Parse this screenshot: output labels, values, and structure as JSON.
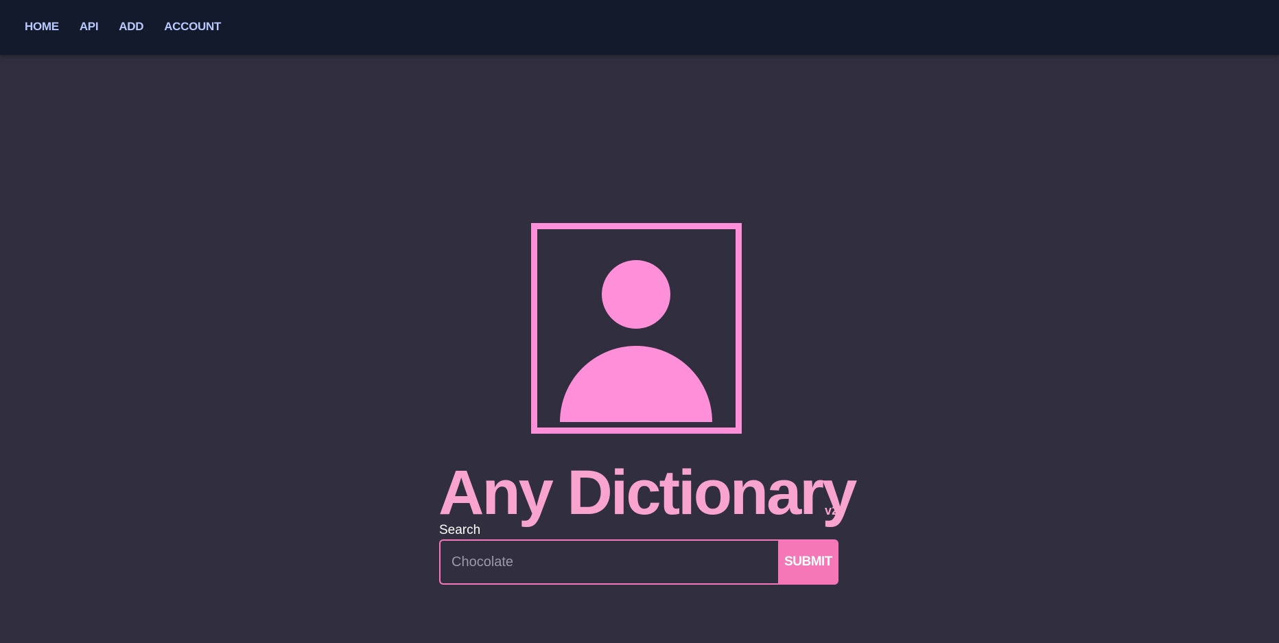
{
  "nav": {
    "items": [
      {
        "label": "HOME"
      },
      {
        "label": "API"
      },
      {
        "label": "ADD"
      },
      {
        "label": "ACCOUNT"
      }
    ]
  },
  "hero": {
    "icon": "user-placeholder-icon",
    "title": "Any Dictionary",
    "version": "v2"
  },
  "search": {
    "label": "Search",
    "placeholder": "Chocolate",
    "value": "",
    "submit_label": "SUBMIT"
  },
  "colors": {
    "background": "#312f3f",
    "navbar": "#131a2b",
    "nav_text": "#b9c8ff",
    "accent": "#f577b8",
    "icon": "#ff8fd9",
    "title": "#f9a4cf"
  }
}
